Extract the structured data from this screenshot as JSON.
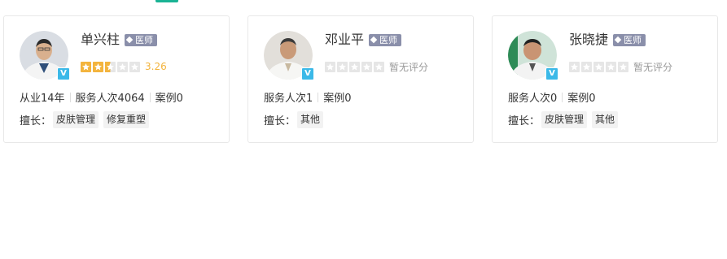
{
  "accent_color": "#1ab394",
  "star_color": "#f3b43d",
  "doctors": [
    {
      "name": "单兴柱",
      "title": "医师",
      "verified_badge": "V",
      "rating_value": 3.26,
      "rating_text": "3.26",
      "rating_stars_filled": 2.5,
      "stats": [
        "从业14年",
        "服务人次4064",
        "案例0"
      ],
      "skills_label": "擅长：",
      "skills": [
        "皮肤管理",
        "修复重塑"
      ]
    },
    {
      "name": "邓业平",
      "title": "医师",
      "verified_badge": "V",
      "rating_value": null,
      "rating_text": "暂无评分",
      "rating_stars_filled": 0,
      "stats": [
        "服务人次1",
        "案例0"
      ],
      "skills_label": "擅长：",
      "skills": [
        "其他"
      ]
    },
    {
      "name": "张晓捷",
      "title": "医师",
      "verified_badge": "V",
      "rating_value": null,
      "rating_text": "暂无评分",
      "rating_stars_filled": 0,
      "stats": [
        "服务人次0",
        "案例0"
      ],
      "skills_label": "擅长：",
      "skills": [
        "皮肤管理",
        "其他"
      ]
    }
  ]
}
